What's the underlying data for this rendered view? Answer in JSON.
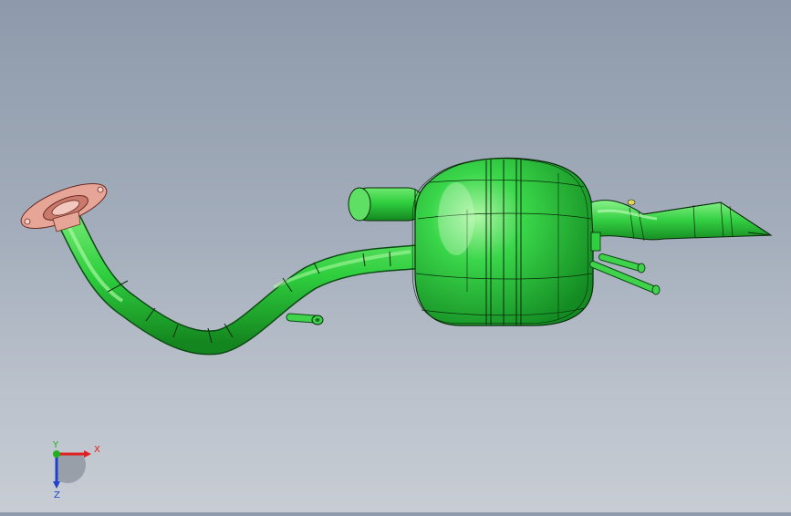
{
  "viewport": {
    "model": "exhaust-muffler-assembly",
    "background_top": "#8e9aab",
    "background_bottom": "#c8cdd4"
  },
  "colors": {
    "part_green": "#22c23a",
    "part_green_light": "#7ef07f",
    "edge_dark": "#0a2a0a",
    "flange_pink": "#e8a79b",
    "axis_x": "#e02020",
    "axis_y": "#20b020",
    "axis_z": "#2040d0"
  },
  "triad": {
    "x_label": "X",
    "y_label": "Y",
    "z_label": "Z"
  }
}
